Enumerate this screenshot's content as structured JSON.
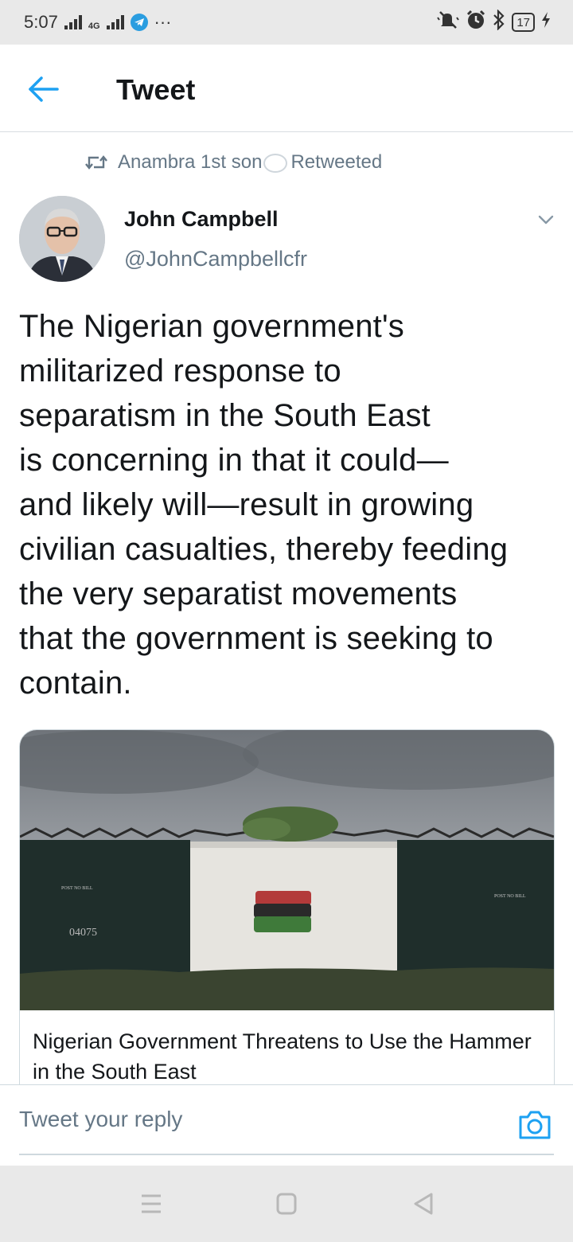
{
  "status_bar": {
    "time": "5:07",
    "network_label": "4G",
    "more_dots": "···",
    "battery_level": "17"
  },
  "app_bar": {
    "title": "Tweet"
  },
  "tweet": {
    "retweet_context": {
      "retweeter": "Anambra 1st son",
      "suffix": "Retweeted"
    },
    "author": {
      "name": "John Campbell",
      "handle": "@JohnCampbellcfr"
    },
    "text": "The Nigerian government's\nmilitarized response to\nseparatism in the South East\nis concerning in that it could—\nand likely will—result in growing\ncivilian casualties, thereby feeding\nthe very separatist movements\nthat the government is seeking to\ncontain.",
    "link_card": {
      "title": "Nigerian Government Threatens to Use the Hammer in the South East",
      "image_texts": {
        "left_sign": "POST NO BILL",
        "right_sign": "POST NO BILL",
        "number": "04075"
      }
    }
  },
  "reply_bar": {
    "placeholder": "Tweet your reply"
  },
  "colors": {
    "accent": "#1da1f2",
    "secondary_text": "#657786",
    "primary_text": "#14171a"
  },
  "icons": [
    "back-arrow-icon",
    "retweet-icon",
    "chevron-down-icon",
    "camera-icon",
    "menu-icon",
    "home-icon",
    "back-triangle-icon"
  ]
}
